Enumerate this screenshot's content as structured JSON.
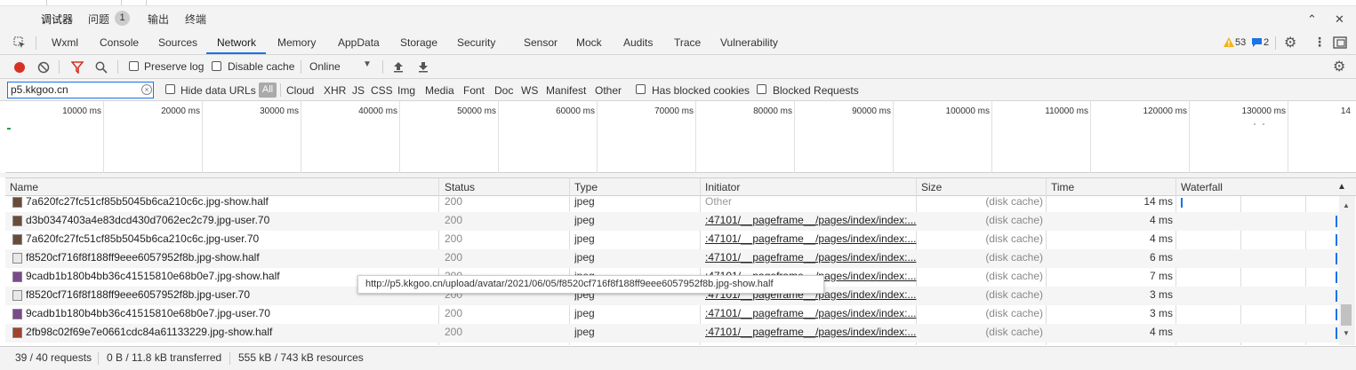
{
  "panel_tabs": [
    {
      "label": "调试器",
      "active": true
    },
    {
      "label": "问题",
      "badge": "1"
    },
    {
      "label": "输出"
    },
    {
      "label": "终端"
    }
  ],
  "window_controls": {
    "collapse": "⌃",
    "close": "✕"
  },
  "devtools_tabs": [
    "Wxml",
    "Console",
    "Sources",
    "Network",
    "Memory",
    "AppData",
    "Storage",
    "Security",
    "Sensor",
    "Mock",
    "Audits",
    "Trace",
    "Vulnerability"
  ],
  "active_tab": "Network",
  "counts": {
    "warnings": "53",
    "messages": "2"
  },
  "toolbar": {
    "preserve_log": "Preserve log",
    "disable_cache": "Disable cache",
    "throttle": "Online"
  },
  "filter": {
    "value": "p5.kkgoo.cn",
    "hide_data_urls": "Hide data URLs",
    "all": "All",
    "types": [
      "Cloud",
      "XHR",
      "JS",
      "CSS",
      "Img",
      "Media",
      "Font",
      "Doc",
      "WS",
      "Manifest",
      "Other"
    ],
    "has_blocked_cookies": "Has blocked cookies",
    "blocked_requests": "Blocked Requests"
  },
  "timeline_ticks": [
    "10000 ms",
    "20000 ms",
    "30000 ms",
    "40000 ms",
    "50000 ms",
    "60000 ms",
    "70000 ms",
    "80000 ms",
    "90000 ms",
    "100000 ms",
    "110000 ms",
    "120000 ms",
    "130000 ms",
    "14"
  ],
  "columns": {
    "name": "Name",
    "status": "Status",
    "type": "Type",
    "initiator": "Initiator",
    "size": "Size",
    "time": "Time",
    "waterfall": "Waterfall"
  },
  "rows": [
    {
      "name": "7a620fc27fc51cf85b5045b6ca210c6c.jpg-show.half",
      "status": "200",
      "type": "jpeg",
      "initiator": "Other",
      "size": "(disk cache)",
      "time": "14 ms",
      "icon": "brown"
    },
    {
      "name": "d3b0347403a4e83dcd430d7062ec2c79.jpg-user.70",
      "status": "200",
      "type": "jpeg",
      "initiator": ":47101/__pageframe__/pages/index/index:...",
      "size": "(disk cache)",
      "time": "4 ms",
      "icon": "brown"
    },
    {
      "name": "7a620fc27fc51cf85b5045b6ca210c6c.jpg-user.70",
      "status": "200",
      "type": "jpeg",
      "initiator": ":47101/__pageframe__/pages/index/index:...",
      "size": "(disk cache)",
      "time": "4 ms",
      "icon": "brown"
    },
    {
      "name": "f8520cf716f8f188ff9eee6057952f8b.jpg-show.half",
      "status": "200",
      "type": "jpeg",
      "initiator": ":47101/__pageframe__/pages/index/index:...",
      "size": "(disk cache)",
      "time": "6 ms",
      "icon": "light"
    },
    {
      "name": "9cadb1b180b4bb36c41515810e68b0e7.jpg-show.half",
      "status": "200",
      "type": "jpeg",
      "initiator": ":47101/__pageframe__/pages/index/index:...",
      "size": "(disk cache)",
      "time": "7 ms",
      "icon": "purple"
    },
    {
      "name": "f8520cf716f8f188ff9eee6057952f8b.jpg-user.70",
      "status": "200",
      "type": "jpeg",
      "initiator": ":47101/__pageframe__/pages/index/index:...",
      "size": "(disk cache)",
      "time": "3 ms",
      "icon": "light"
    },
    {
      "name": "9cadb1b180b4bb36c41515810e68b0e7.jpg-user.70",
      "status": "200",
      "type": "jpeg",
      "initiator": ":47101/__pageframe__/pages/index/index:...",
      "size": "(disk cache)",
      "time": "3 ms",
      "icon": "purple"
    },
    {
      "name": "2fb98c02f69e7e0661cdc84a61133229.jpg-show.half",
      "status": "200",
      "type": "jpeg",
      "initiator": ":47101/__pageframe__/pages/index/index:...",
      "size": "(disk cache)",
      "time": "4 ms",
      "icon": "red"
    }
  ],
  "tooltip": "http://p5.kkgoo.cn/upload/avatar/2021/06/05/f8520cf716f8f188ff9eee6057952f8b.jpg-show.half",
  "status_bar": {
    "requests": "39 / 40 requests",
    "transferred": "0 B / 11.8 kB transferred",
    "resources": "555 kB / 743 kB resources"
  }
}
